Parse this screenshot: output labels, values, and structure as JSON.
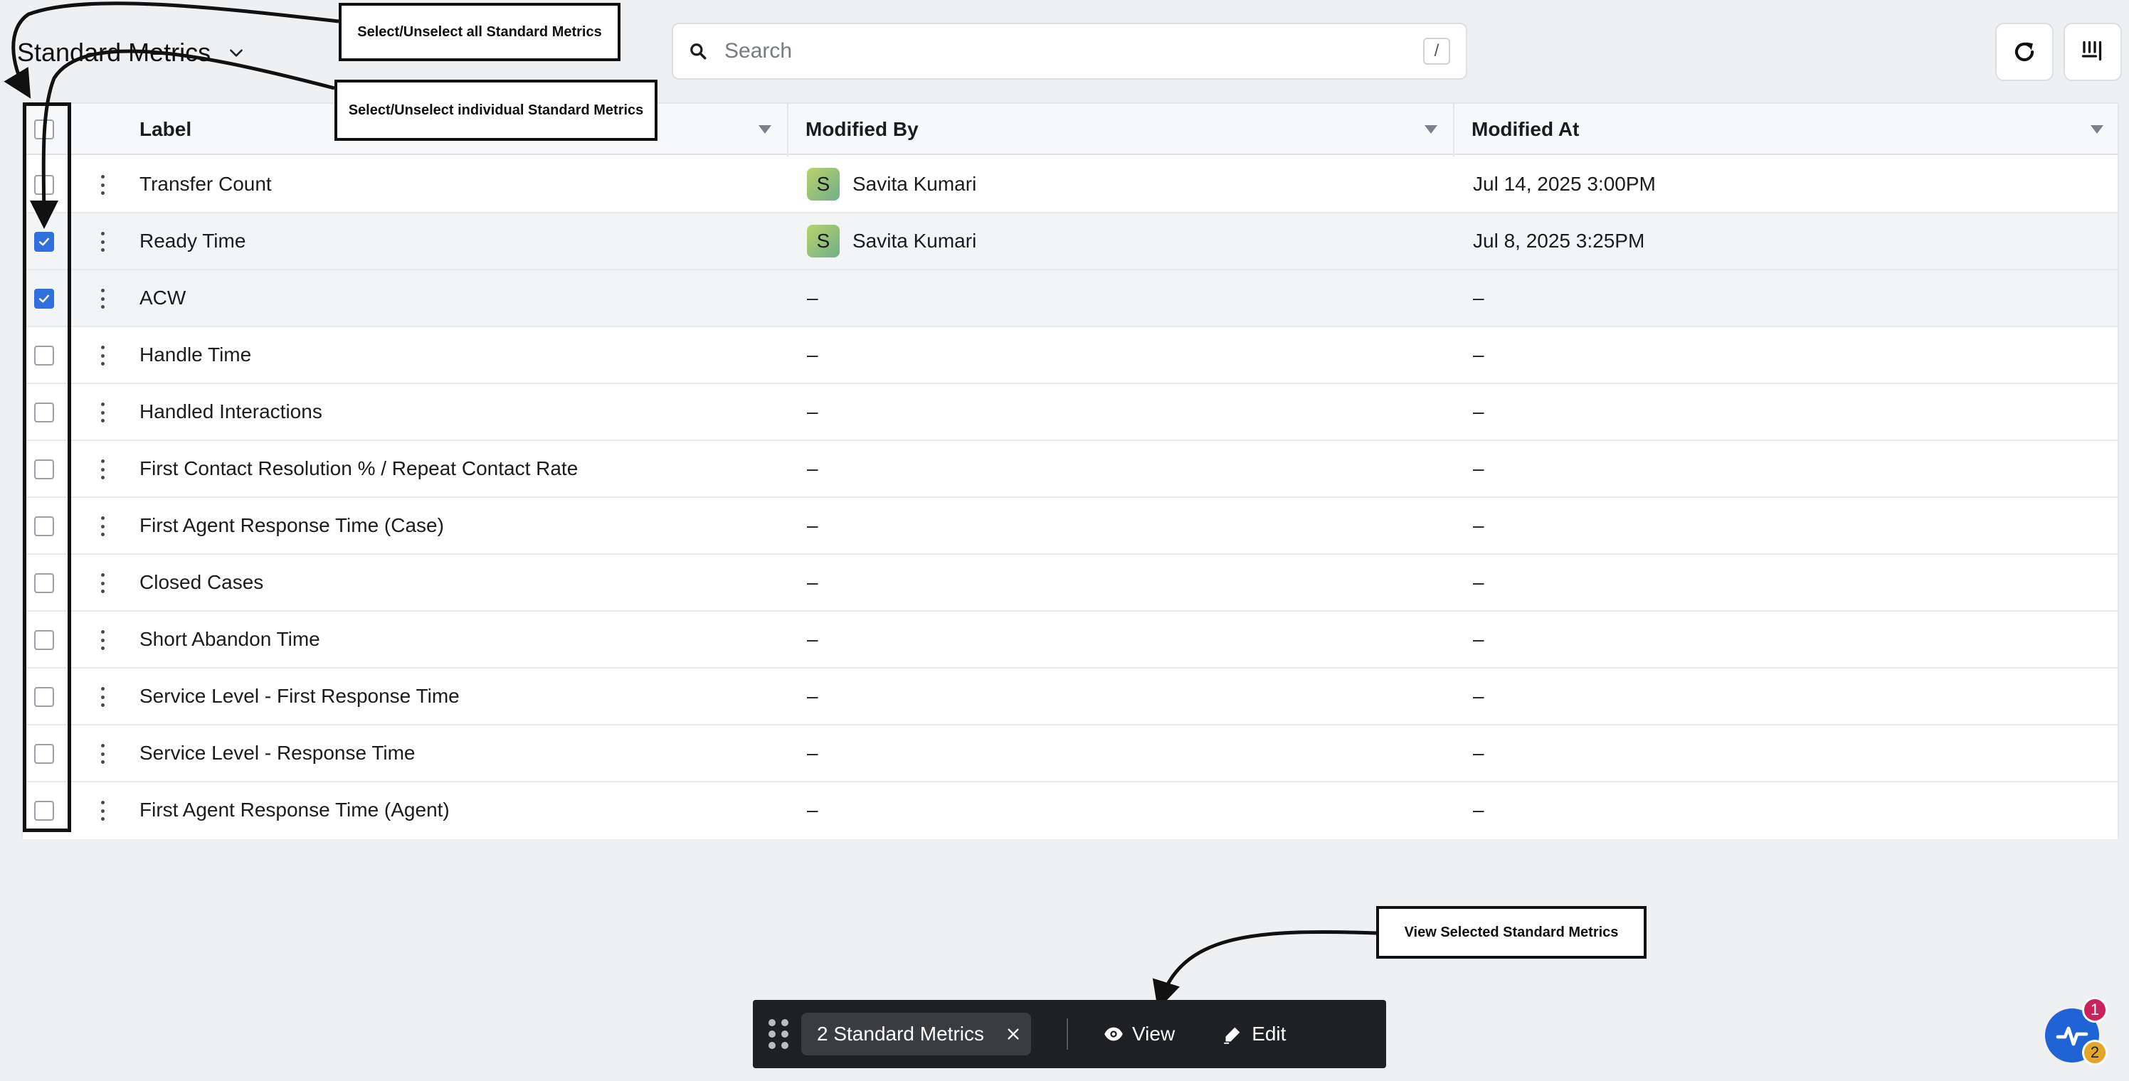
{
  "header": {
    "title": "Standard Metrics",
    "search_placeholder": "Search",
    "search_shortcut": "/",
    "refresh_icon": "refresh-icon",
    "columns_icon": "column-settings-icon"
  },
  "table": {
    "columns": [
      "Label",
      "Modified By",
      "Modified At"
    ],
    "rows": [
      {
        "label": "Transfer Count",
        "modified_by": "Savita Kumari",
        "avatar": "S",
        "modified_at": "Jul 14, 2025 3:00PM",
        "checked": false
      },
      {
        "label": "Ready Time",
        "modified_by": "Savita Kumari",
        "avatar": "S",
        "modified_at": "Jul 8, 2025 3:25PM",
        "checked": true
      },
      {
        "label": "ACW",
        "modified_by": "–",
        "avatar": "",
        "modified_at": "–",
        "checked": true
      },
      {
        "label": "Handle Time",
        "modified_by": "–",
        "avatar": "",
        "modified_at": "–",
        "checked": false
      },
      {
        "label": "Handled Interactions",
        "modified_by": "–",
        "avatar": "",
        "modified_at": "–",
        "checked": false
      },
      {
        "label": "First Contact Resolution % / Repeat Contact Rate",
        "modified_by": "–",
        "avatar": "",
        "modified_at": "–",
        "checked": false
      },
      {
        "label": "First Agent Response Time (Case)",
        "modified_by": "–",
        "avatar": "",
        "modified_at": "–",
        "checked": false
      },
      {
        "label": "Closed Cases",
        "modified_by": "–",
        "avatar": "",
        "modified_at": "–",
        "checked": false
      },
      {
        "label": "Short Abandon Time",
        "modified_by": "–",
        "avatar": "",
        "modified_at": "–",
        "checked": false
      },
      {
        "label": "Service Level - First Response Time",
        "modified_by": "–",
        "avatar": "",
        "modified_at": "–",
        "checked": false
      },
      {
        "label": "Service Level - Response Time",
        "modified_by": "–",
        "avatar": "",
        "modified_at": "–",
        "checked": false
      },
      {
        "label": "First Agent Response Time (Agent)",
        "modified_by": "–",
        "avatar": "",
        "modified_at": "–",
        "checked": false
      }
    ]
  },
  "annotations": {
    "select_all": "Select/Unselect all Standard Metrics",
    "select_individual": "Select/Unselect individual Standard Metrics",
    "view_selected": "View Selected Standard Metrics"
  },
  "action_bar": {
    "selection_label": "2 Standard Metrics",
    "view_label": "View",
    "edit_label": "Edit"
  },
  "widget": {
    "badge_top": "1",
    "badge_bottom": "2",
    "badge_top_color": "#c8245b",
    "badge_bottom_color": "#e3a52a"
  },
  "colors": {
    "accent": "#2f6fe0",
    "action_bar_bg": "#1f2023"
  }
}
